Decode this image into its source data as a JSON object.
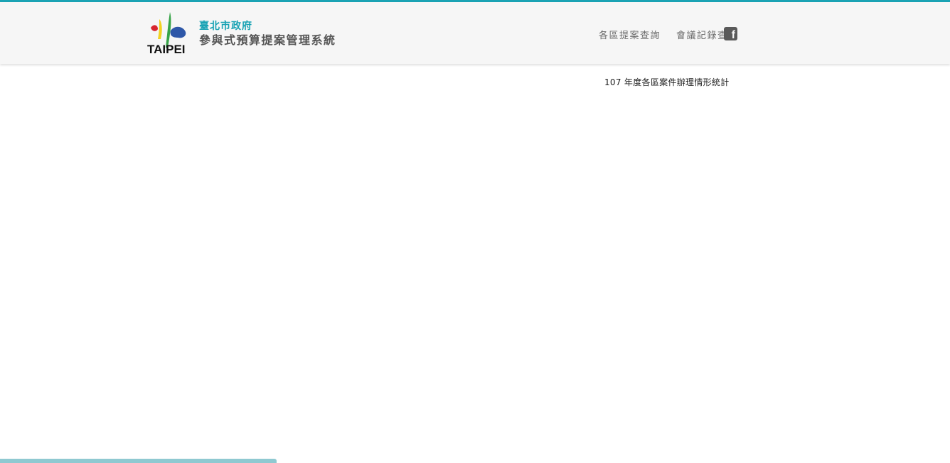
{
  "header": {
    "org_name": "臺北市政府",
    "system_name": "參與式預算提案管理系統",
    "logo_text": "TAIPEI"
  },
  "nav": {
    "items": [
      {
        "label": "各區提案查詢"
      },
      {
        "label": "會議記錄查詢"
      }
    ],
    "facebook_icon": "facebook-icon"
  },
  "main": {
    "title": "107 年度各區案件辦理情形統計"
  },
  "colors": {
    "accent": "#1aa3b4",
    "header_bg": "#f6f6f6",
    "nav_text": "#6b6b6b",
    "bottom_bar": "#8fc9d1"
  }
}
